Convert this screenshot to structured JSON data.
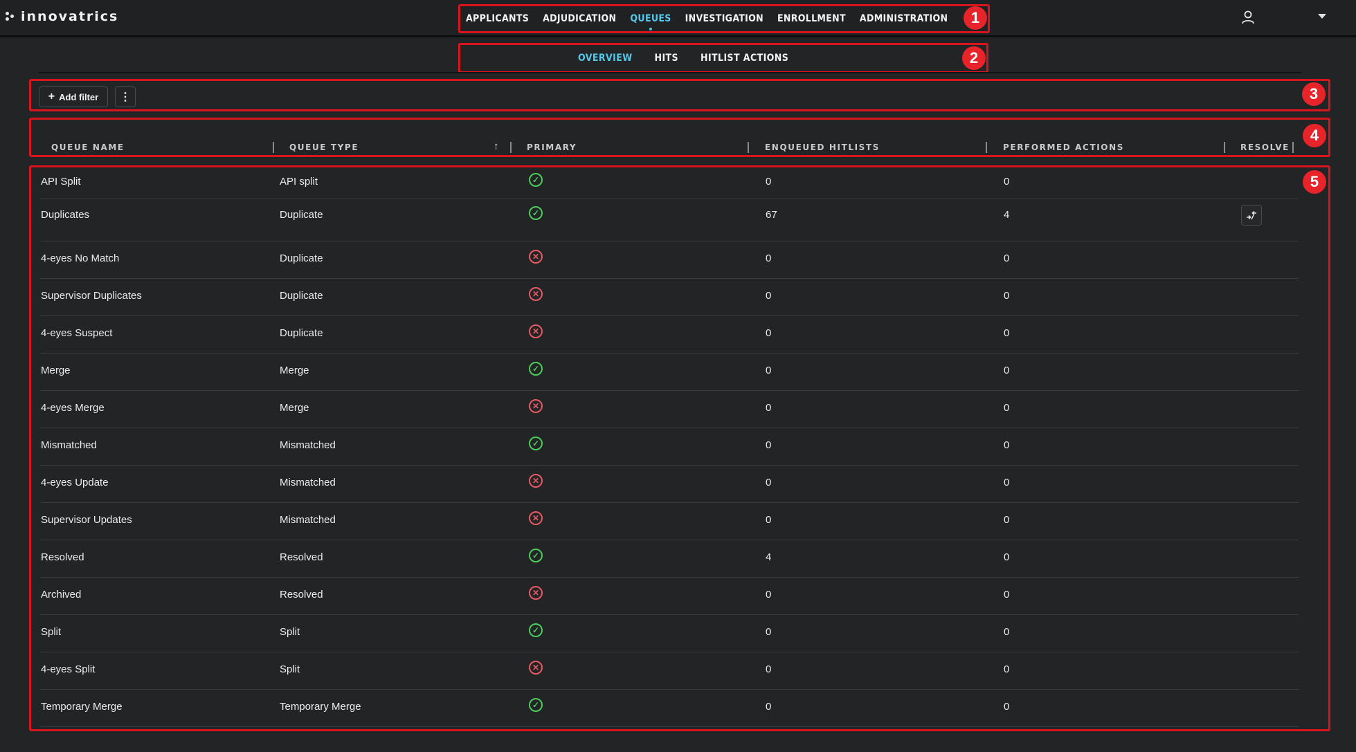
{
  "brand": {
    "name": "innovatrics"
  },
  "main_nav": {
    "items": [
      {
        "label": "APPLICANTS"
      },
      {
        "label": "ADJUDICATION"
      },
      {
        "label": "QUEUES",
        "active": true
      },
      {
        "label": "INVESTIGATION"
      },
      {
        "label": "ENROLLMENT"
      },
      {
        "label": "ADMINISTRATION"
      }
    ]
  },
  "sub_nav": {
    "items": [
      {
        "label": "OVERVIEW",
        "active": true
      },
      {
        "label": "HITS"
      },
      {
        "label": "HITLIST ACTIONS"
      }
    ]
  },
  "toolbar": {
    "add_filter_label": "Add filter",
    "add_icon": "+",
    "more_icon": "⋮"
  },
  "table": {
    "columns": [
      {
        "label": "QUEUE NAME"
      },
      {
        "label": "QUEUE TYPE",
        "sort": "ascending"
      },
      {
        "label": "PRIMARY"
      },
      {
        "label": "ENQUEUED HITLISTS"
      },
      {
        "label": "PERFORMED ACTIONS"
      },
      {
        "label": "RESOLVE"
      }
    ],
    "rows": [
      {
        "name": "API Split",
        "type": "API split",
        "primary": true,
        "enqueued": "0",
        "performed": "0",
        "resolve": false
      },
      {
        "name": "Duplicates",
        "type": "Duplicate",
        "primary": true,
        "enqueued": "67",
        "performed": "4",
        "resolve": true
      },
      {
        "name": "4-eyes No Match",
        "type": "Duplicate",
        "primary": false,
        "enqueued": "0",
        "performed": "0",
        "resolve": false
      },
      {
        "name": "Supervisor Duplicates",
        "type": "Duplicate",
        "primary": false,
        "enqueued": "0",
        "performed": "0",
        "resolve": false
      },
      {
        "name": "4-eyes Suspect",
        "type": "Duplicate",
        "primary": false,
        "enqueued": "0",
        "performed": "0",
        "resolve": false
      },
      {
        "name": "Merge",
        "type": "Merge",
        "primary": true,
        "enqueued": "0",
        "performed": "0",
        "resolve": false
      },
      {
        "name": "4-eyes Merge",
        "type": "Merge",
        "primary": false,
        "enqueued": "0",
        "performed": "0",
        "resolve": false
      },
      {
        "name": "Mismatched",
        "type": "Mismatched",
        "primary": true,
        "enqueued": "0",
        "performed": "0",
        "resolve": false
      },
      {
        "name": "4-eyes Update",
        "type": "Mismatched",
        "primary": false,
        "enqueued": "0",
        "performed": "0",
        "resolve": false
      },
      {
        "name": "Supervisor Updates",
        "type": "Mismatched",
        "primary": false,
        "enqueued": "0",
        "performed": "0",
        "resolve": false
      },
      {
        "name": "Resolved",
        "type": "Resolved",
        "primary": true,
        "enqueued": "4",
        "performed": "0",
        "resolve": false
      },
      {
        "name": "Archived",
        "type": "Resolved",
        "primary": false,
        "enqueued": "0",
        "performed": "0",
        "resolve": false
      },
      {
        "name": "Split",
        "type": "Split",
        "primary": true,
        "enqueued": "0",
        "performed": "0",
        "resolve": false
      },
      {
        "name": "4-eyes Split",
        "type": "Split",
        "primary": false,
        "enqueued": "0",
        "performed": "0",
        "resolve": false
      },
      {
        "name": "Temporary Merge",
        "type": "Temporary Merge",
        "primary": true,
        "enqueued": "0",
        "performed": "0",
        "resolve": false
      }
    ]
  },
  "markers": [
    "1",
    "2",
    "3",
    "4",
    "5"
  ],
  "colors": {
    "accent": "#56c8ea",
    "annotation": "#d9141c",
    "primary_yes": "#4ccd5b",
    "primary_no": "#e85a63",
    "background": "#222426"
  },
  "icons": {
    "primary_yes": "check-circle-icon",
    "primary_no": "x-circle-icon",
    "resolve": "resolve-icon",
    "user": "user-icon",
    "dropdown": "chevron-down-icon",
    "sort": "sort-ascending-icon"
  }
}
